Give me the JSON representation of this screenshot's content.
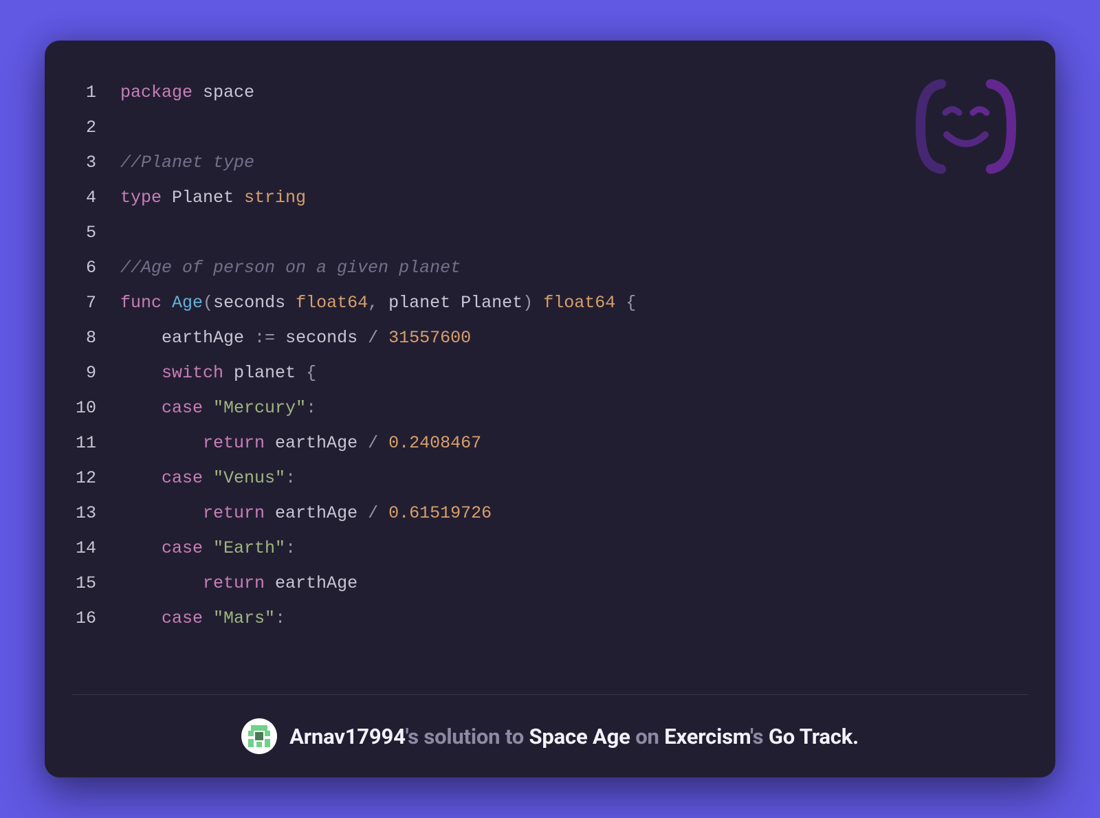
{
  "code": {
    "lines": [
      {
        "n": 1,
        "tokens": [
          [
            "kw",
            "package"
          ],
          [
            "ident",
            " space"
          ]
        ]
      },
      {
        "n": 2,
        "tokens": []
      },
      {
        "n": 3,
        "tokens": [
          [
            "comment",
            "//Planet type"
          ]
        ]
      },
      {
        "n": 4,
        "tokens": [
          [
            "kw",
            "type"
          ],
          [
            "ident",
            " Planet "
          ],
          [
            "type",
            "string"
          ]
        ]
      },
      {
        "n": 5,
        "tokens": []
      },
      {
        "n": 6,
        "tokens": [
          [
            "comment",
            "//Age of person on a given planet"
          ]
        ]
      },
      {
        "n": 7,
        "tokens": [
          [
            "kw",
            "func"
          ],
          [
            "ident",
            " "
          ],
          [
            "func",
            "Age"
          ],
          [
            "punct",
            "("
          ],
          [
            "ident",
            "seconds "
          ],
          [
            "type",
            "float64"
          ],
          [
            "punct",
            ","
          ],
          [
            "ident",
            " planet Planet"
          ],
          [
            "punct",
            ") "
          ],
          [
            "type",
            "float64"
          ],
          [
            "punct",
            " {"
          ]
        ]
      },
      {
        "n": 8,
        "tokens": [
          [
            "ident",
            "    earthAge "
          ],
          [
            "punct",
            ":="
          ],
          [
            "ident",
            " seconds "
          ],
          [
            "punct",
            "/"
          ],
          [
            "ident",
            " "
          ],
          [
            "num",
            "31557600"
          ]
        ]
      },
      {
        "n": 9,
        "tokens": [
          [
            "ident",
            "    "
          ],
          [
            "kw",
            "switch"
          ],
          [
            "ident",
            " planet "
          ],
          [
            "punct",
            "{"
          ]
        ]
      },
      {
        "n": 10,
        "tokens": [
          [
            "ident",
            "    "
          ],
          [
            "kw",
            "case"
          ],
          [
            "ident",
            " "
          ],
          [
            "str",
            "\"Mercury\""
          ],
          [
            "punct",
            ":"
          ]
        ]
      },
      {
        "n": 11,
        "tokens": [
          [
            "ident",
            "        "
          ],
          [
            "kw",
            "return"
          ],
          [
            "ident",
            " earthAge "
          ],
          [
            "punct",
            "/"
          ],
          [
            "ident",
            " "
          ],
          [
            "num",
            "0.2408467"
          ]
        ]
      },
      {
        "n": 12,
        "tokens": [
          [
            "ident",
            "    "
          ],
          [
            "kw",
            "case"
          ],
          [
            "ident",
            " "
          ],
          [
            "str",
            "\"Venus\""
          ],
          [
            "punct",
            ":"
          ]
        ]
      },
      {
        "n": 13,
        "tokens": [
          [
            "ident",
            "        "
          ],
          [
            "kw",
            "return"
          ],
          [
            "ident",
            " earthAge "
          ],
          [
            "punct",
            "/"
          ],
          [
            "ident",
            " "
          ],
          [
            "num",
            "0.61519726"
          ]
        ]
      },
      {
        "n": 14,
        "tokens": [
          [
            "ident",
            "    "
          ],
          [
            "kw",
            "case"
          ],
          [
            "ident",
            " "
          ],
          [
            "str",
            "\"Earth\""
          ],
          [
            "punct",
            ":"
          ]
        ]
      },
      {
        "n": 15,
        "tokens": [
          [
            "ident",
            "        "
          ],
          [
            "kw",
            "return"
          ],
          [
            "ident",
            " earthAge"
          ]
        ]
      },
      {
        "n": 16,
        "tokens": [
          [
            "ident",
            "    "
          ],
          [
            "kw",
            "case"
          ],
          [
            "ident",
            " "
          ],
          [
            "str",
            "\"Mars\""
          ],
          [
            "punct",
            ":"
          ]
        ]
      }
    ]
  },
  "footer": {
    "username": "Arnav17994",
    "s_possessive": "'s ",
    "solution_to": "solution to ",
    "exercise": "Space Age",
    "on": " on ",
    "platform": "Exercism",
    "platform_possessive": "'s ",
    "track": "Go Track."
  }
}
